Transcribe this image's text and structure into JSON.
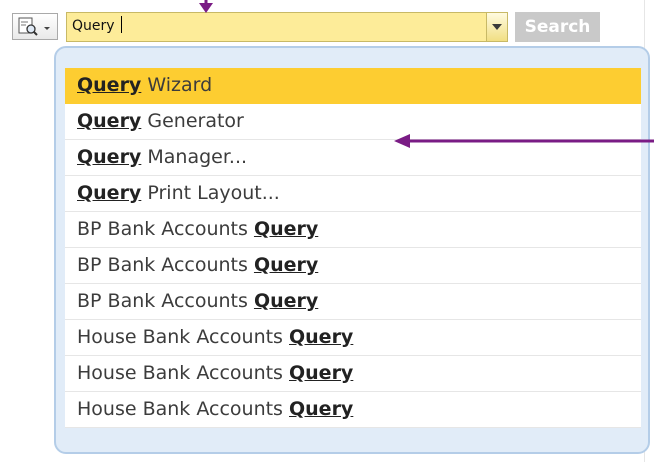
{
  "toolbar": {
    "search_value": "Query",
    "search_button_label": "Search"
  },
  "dropdown": {
    "items": [
      {
        "keyword": "Query",
        "text": " Wizard",
        "keyword_first": true,
        "selected": true
      },
      {
        "keyword": "Query",
        "text": " Generator",
        "keyword_first": true,
        "selected": false
      },
      {
        "keyword": "Query",
        "text": " Manager...",
        "keyword_first": true,
        "selected": false
      },
      {
        "keyword": "Query",
        "text": " Print Layout...",
        "keyword_first": true,
        "selected": false
      },
      {
        "keyword": "Query",
        "text": "BP Bank Accounts ",
        "keyword_first": false,
        "selected": false
      },
      {
        "keyword": "Query",
        "text": "BP Bank Accounts ",
        "keyword_first": false,
        "selected": false
      },
      {
        "keyword": "Query",
        "text": "BP Bank Accounts ",
        "keyword_first": false,
        "selected": false
      },
      {
        "keyword": "Query",
        "text": "House Bank Accounts ",
        "keyword_first": false,
        "selected": false
      },
      {
        "keyword": "Query",
        "text": "House Bank Accounts ",
        "keyword_first": false,
        "selected": false
      },
      {
        "keyword": "Query",
        "text": "House Bank Accounts ",
        "keyword_first": false,
        "selected": false
      }
    ]
  },
  "colors": {
    "search_field_bg": "#fdec99",
    "selected_item_bg": "#fdcd31",
    "dropdown_frame": "#b4cde8",
    "annotation_arrow": "#7a1c85"
  },
  "icons": {
    "preview_button": "magnifier-document-icon",
    "dropdown_toggle": "triangle-down-icon"
  }
}
